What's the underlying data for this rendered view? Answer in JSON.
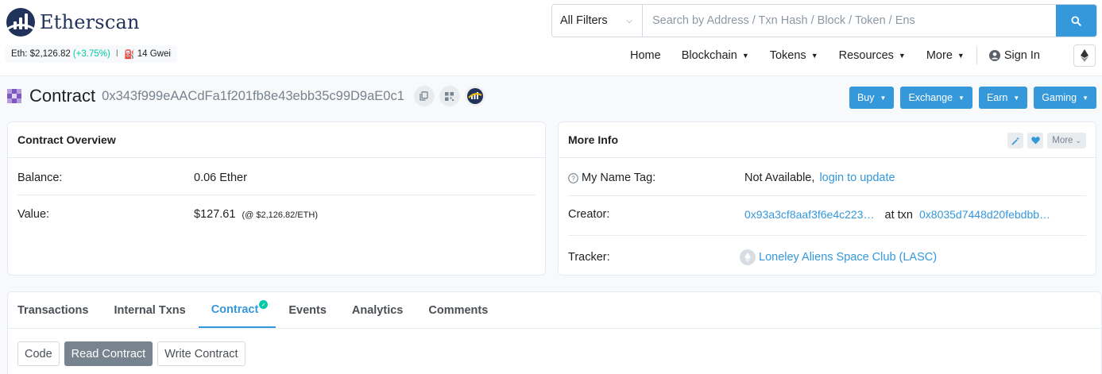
{
  "header": {
    "logo_text": "Etherscan",
    "eth_price_label": "Eth: $2,126.82",
    "eth_change": "(+3.75%)",
    "separator": "I",
    "gas": "14 Gwei",
    "search": {
      "filter": "All Filters",
      "placeholder": "Search by Address / Txn Hash / Block / Token / Ens"
    },
    "nav": {
      "home": "Home",
      "blockchain": "Blockchain",
      "tokens": "Tokens",
      "resources": "Resources",
      "more": "More",
      "sign_in": "Sign In"
    }
  },
  "title": {
    "label": "Contract",
    "address": "0x343f999eAACdFa1f201fb8e43ebb35c99D9aE0c1"
  },
  "actions": {
    "buy": "Buy",
    "exchange": "Exchange",
    "earn": "Earn",
    "gaming": "Gaming"
  },
  "overview": {
    "title": "Contract Overview",
    "balance_label": "Balance:",
    "balance_value": "0.06 Ether",
    "value_label": "Value:",
    "value_value": "$127.61",
    "value_rate": "(@ $2,126.82/ETH)"
  },
  "more_info": {
    "title": "More Info",
    "more_button": "More",
    "name_tag_label": "My Name Tag:",
    "name_tag_value": "Not Available,",
    "name_tag_link": "login to update",
    "creator_label": "Creator:",
    "creator_address": "0x93a3cf8aaf3f6e4c223…",
    "at_txn": "at txn",
    "creator_txn": "0x8035d7448d20febdbb…",
    "tracker_label": "Tracker:",
    "tracker_value": "Loneley Aliens Space Club (LASC)"
  },
  "tabs": {
    "transactions": "Transactions",
    "internal": "Internal Txns",
    "contract": "Contract",
    "events": "Events",
    "analytics": "Analytics",
    "comments": "Comments"
  },
  "subtabs": {
    "code": "Code",
    "read": "Read Contract",
    "write": "Write Contract"
  },
  "colors": {
    "primary": "#3498db",
    "success": "#00c9a7",
    "navy": "#21325b"
  }
}
